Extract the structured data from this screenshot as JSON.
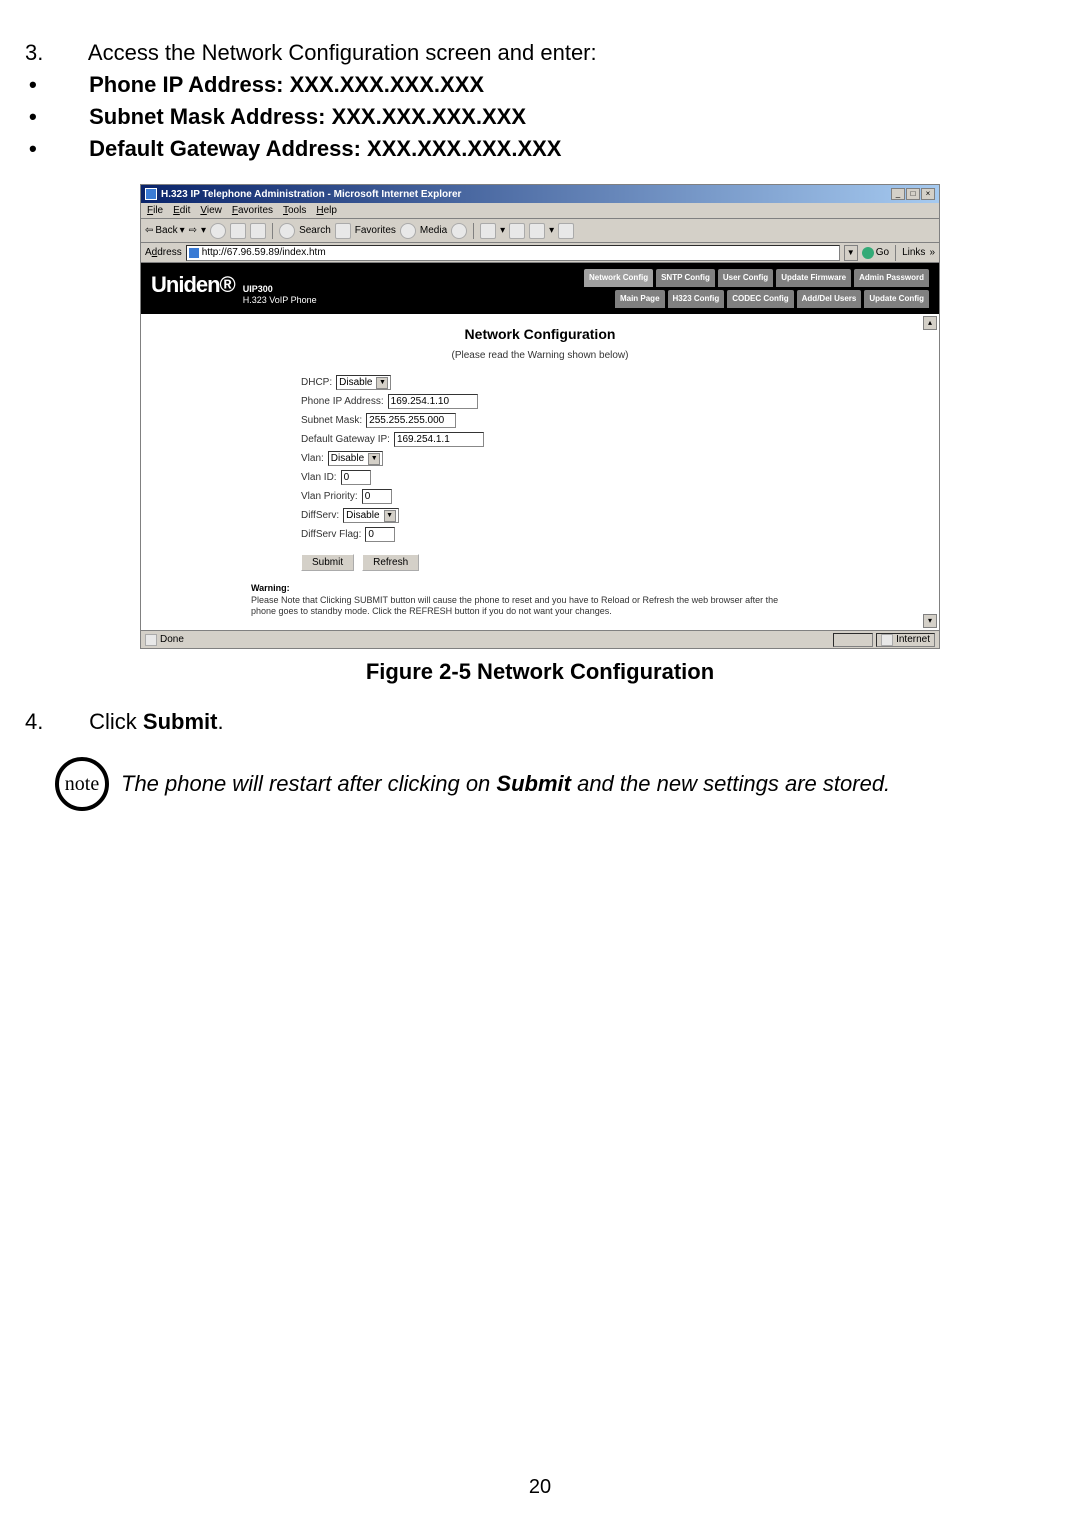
{
  "step3_prefix": "3.",
  "step3_text": "Access the Network Configuration screen and enter:",
  "bullets": [
    "Phone IP Address: XXX.XXX.XXX.XXX",
    "Subnet Mask Address: XXX.XXX.XXX.XXX",
    "Default Gateway Address: XXX.XXX.XXX.XXX"
  ],
  "window": {
    "title": "H.323 IP Telephone Administration - Microsoft Internet Explorer",
    "menus": [
      "File",
      "Edit",
      "View",
      "Favorites",
      "Tools",
      "Help"
    ],
    "toolbar": {
      "back": "Back",
      "search": "Search",
      "favorites": "Favorites",
      "media": "Media"
    },
    "address_label": "Address",
    "address_value": "http://67.96.59.89/index.htm",
    "go": "Go",
    "links": "Links",
    "win_min": "_",
    "win_max": "□",
    "win_close": "×"
  },
  "page": {
    "logo": "Uniden®",
    "logo_sub1": "UIP300",
    "logo_sub2": "H.323 VoIP Phone",
    "tabs_row1": [
      "Network Config",
      "SNTP Config",
      "User Config",
      "Update Firmware",
      "Admin Password"
    ],
    "tabs_row2": [
      "Main Page",
      "H323 Config",
      "CODEC Config",
      "Add/Del Users",
      "Update Config"
    ],
    "title": "Network Configuration",
    "subtitle": "(Please read the Warning shown below)",
    "fields": {
      "dhcp_label": "DHCP:",
      "dhcp_value": "Disable",
      "phone_ip_label": "Phone IP Address:",
      "phone_ip_value": "169.254.1.10",
      "subnet_label": "Subnet Mask:",
      "subnet_value": "255.255.255.000",
      "gateway_label": "Default Gateway IP:",
      "gateway_value": "169.254.1.1",
      "vlan_label": "Vlan:",
      "vlan_value": "Disable",
      "vlanid_label": "Vlan ID:",
      "vlanid_value": "0",
      "vlanpri_label": "Vlan Priority:",
      "vlanpri_value": "0",
      "diffserv_label": "DiffServ:",
      "diffserv_value": "Disable",
      "diffflag_label": "DiffServ Flag:",
      "diffflag_value": "0"
    },
    "submit_btn": "Submit",
    "refresh_btn": "Refresh",
    "warning_title": "Warning:",
    "warning_body": "Please Note that Clicking SUBMIT button will cause the phone to reset and you have to Reload or Refresh the web browser after the phone goes to standby mode. Click the REFRESH button if you do not want your changes."
  },
  "status": {
    "done": "Done",
    "zone": "Internet"
  },
  "figure_caption": "Figure 2-5 Network Configuration",
  "step4_prefix": "4.",
  "step4_pre": "Click ",
  "step4_bold": "Submit",
  "step4_post": ".",
  "note_badge": "note",
  "note_pre": "The phone will restart after clicking on ",
  "note_bold": "Submit",
  "note_post": " and the new settings are stored.",
  "page_num": "20"
}
